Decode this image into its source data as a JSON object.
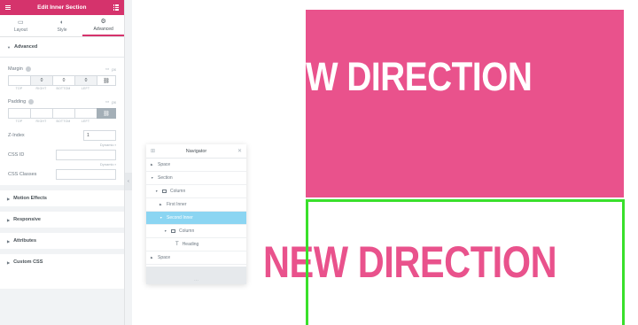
{
  "panel": {
    "title": "Edit Inner Section",
    "tabs": [
      {
        "label": "Layout",
        "icon": "layout-icon"
      },
      {
        "label": "Style",
        "icon": "style-icon"
      },
      {
        "label": "Advanced",
        "icon": "gear-icon",
        "active": true
      }
    ],
    "section": "Advanced",
    "margin": {
      "label": "Margin",
      "unit": "px",
      "values": {
        "top": "",
        "right": "0",
        "bottom": "0",
        "left": "0"
      },
      "sublabels": [
        "TOP",
        "RIGHT",
        "BOTTOM",
        "LEFT"
      ]
    },
    "padding": {
      "label": "Padding",
      "unit": "px",
      "sublabels": [
        "TOP",
        "RIGHT",
        "BOTTOM",
        "LEFT"
      ]
    },
    "zindex": {
      "label": "Z-Index",
      "value": "1"
    },
    "cssid": {
      "label": "CSS ID"
    },
    "cssclasses": {
      "label": "CSS Classes"
    },
    "dynamic_label": "Dynamic",
    "collapsed_sections": [
      "Motion Effects",
      "Responsive",
      "Attributes",
      "Custom CSS"
    ]
  },
  "navigator": {
    "title": "Navigator",
    "items": [
      {
        "label": "Space",
        "indent": 0,
        "type": "section",
        "expand": "▶"
      },
      {
        "label": "Section",
        "indent": 0,
        "type": "section",
        "expand": "▼"
      },
      {
        "label": "Column",
        "indent": 1,
        "type": "column",
        "expand": "▼"
      },
      {
        "label": "First Inner",
        "indent": 2,
        "type": "section",
        "expand": "▶"
      },
      {
        "label": "Second Inner",
        "indent": 2,
        "type": "section",
        "expand": "▼",
        "selected": true
      },
      {
        "label": "Column",
        "indent": 3,
        "type": "column",
        "expand": "▼"
      },
      {
        "label": "Heading",
        "indent": 4,
        "type": "widget",
        "expand": ""
      },
      {
        "label": "Space",
        "indent": 0,
        "type": "section",
        "expand": "▶"
      }
    ]
  },
  "canvas": {
    "pink_heading": "W DIRECTION",
    "big_heading": "NEW DIRECTION"
  },
  "colors": {
    "brand": "#d5336c",
    "pink": "#e9528c",
    "green_outline": "#39e02b",
    "navigator_selected": "#8bd5f2"
  }
}
